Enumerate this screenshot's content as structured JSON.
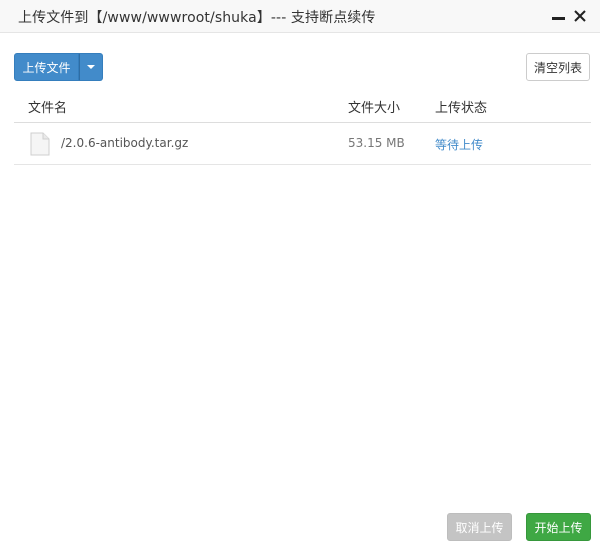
{
  "window": {
    "title": "上传文件到【/www/wwwroot/shuka】--- 支持断点续传",
    "minimize_icon": "minimize-icon",
    "close_icon": "close-icon"
  },
  "toolbar": {
    "upload_label": "上传文件",
    "clear_label": "清空列表"
  },
  "table": {
    "columns": [
      "文件名",
      "文件大小",
      "上传状态"
    ],
    "rows": [
      {
        "icon": "file-icon",
        "name": "/2.0.6-antibody.tar.gz",
        "size": "53.15 MB",
        "status": "等待上传"
      }
    ]
  },
  "footer": {
    "cancel_label": "取消上传",
    "start_label": "开始上传"
  },
  "colors": {
    "primary": "#428bca",
    "success": "#3fa844",
    "disabled": "#c4c4c4",
    "status_link": "#428bca"
  }
}
